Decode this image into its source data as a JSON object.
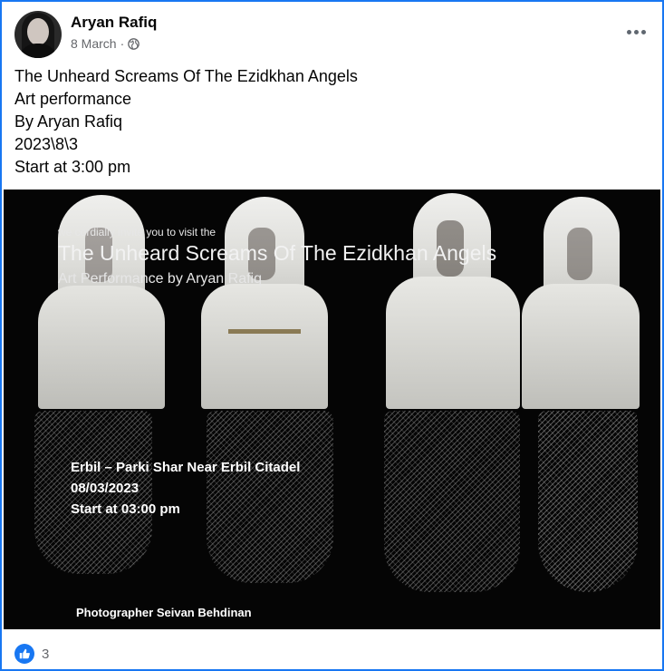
{
  "post": {
    "author": "Aryan Rafiq",
    "date": "8 March",
    "separator": "·",
    "privacy_icon": "globe-icon",
    "menu_icon": "more-options-icon"
  },
  "caption": {
    "lines": [
      "The Unheard Screams Of The Ezidkhan Angels",
      "Art performance",
      "By Aryan Rafiq",
      "2023\\8\\3",
      "Start at 3:00 pm"
    ]
  },
  "image": {
    "invite": "we cordially invite you to visit the",
    "title": "The Unheard Screams Of The Ezidkhan Angels",
    "subtitle": "Art Performance by Aryan Rafiq",
    "venue_lines": [
      "Erbil – Parki Shar Near Erbil Citadel",
      "08/03/2023",
      "Start at 03:00 pm"
    ],
    "credit": "Photographer Seivan Behdinan"
  },
  "reactions": {
    "icon": "like-icon",
    "count": "3",
    "accent": "#1877f2"
  }
}
